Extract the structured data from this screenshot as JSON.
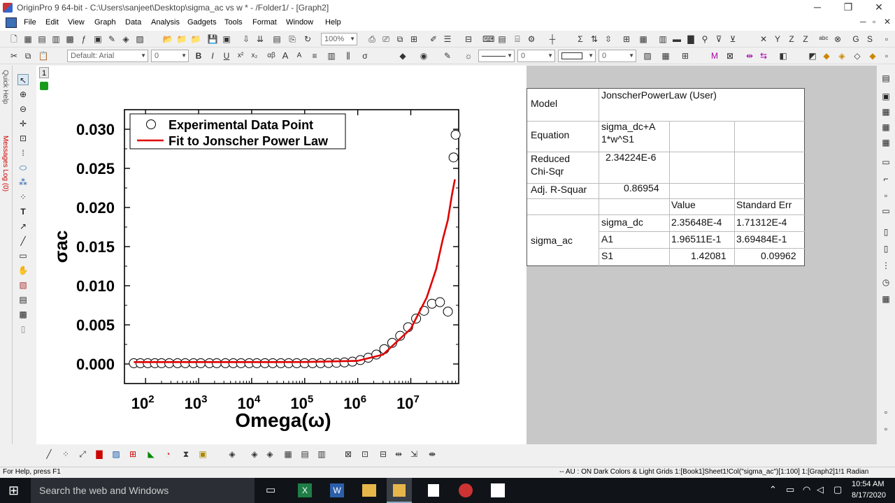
{
  "window": {
    "title": "OriginPro 9 64-bit - C:\\Users\\sanjeet\\Desktop\\sigma_ac vs w * - /Folder1/ - [Graph2]",
    "controls": [
      "─",
      "❐",
      "✕"
    ],
    "mdi_controls": [
      "─",
      "▫",
      "✕"
    ]
  },
  "menu": [
    "File",
    "Edit",
    "View",
    "Graph",
    "Data",
    "Analysis",
    "Gadgets",
    "Tools",
    "Format",
    "Window",
    "Help"
  ],
  "toolbar": {
    "zoom": "100%",
    "font_name": "Default: Arial",
    "font_size": "0",
    "bold": "B",
    "italic": "I",
    "underline": "U",
    "superscript": "x²",
    "subscript": "x₂",
    "greek": "αβ",
    "size_up": "A",
    "size_down": "A",
    "line_width": "0",
    "border_width": "0"
  },
  "sidebar": {
    "quick_help": "Quick Help",
    "messages_log": "Messages Log (0)"
  },
  "layer": {
    "number": "1"
  },
  "graph": {
    "y_title": "σac",
    "x_title": "Omega(ω)",
    "y_ticks": [
      "0.030",
      "0.025",
      "0.020",
      "0.015",
      "0.010",
      "0.005",
      "0.000"
    ],
    "x_ticks": [
      {
        "base": "10",
        "exp": "2"
      },
      {
        "base": "10",
        "exp": "3"
      },
      {
        "base": "10",
        "exp": "4"
      },
      {
        "base": "10",
        "exp": "5"
      },
      {
        "base": "10",
        "exp": "6"
      },
      {
        "base": "10",
        "exp": "7"
      }
    ],
    "legend": [
      "Experimental Data Point",
      "Fit to Jonscher Power Law"
    ],
    "colors": {
      "fit": "#e00000",
      "points": "#000000"
    }
  },
  "chart_data": {
    "type": "scatter",
    "title": "",
    "xlabel": "Omega(ω)",
    "ylabel": "σac",
    "x_scale": "log",
    "xlim": [
      40,
      80000000
    ],
    "ylim": [
      -0.0025,
      0.0325
    ],
    "grid": false,
    "legend_position": "top-left",
    "series": [
      {
        "name": "Experimental Data Point",
        "marker": "open-circle",
        "x": [
          60,
          80,
          110,
          150,
          200,
          280,
          400,
          560,
          800,
          1100,
          1600,
          2200,
          3200,
          4500,
          6300,
          9000,
          12500,
          17800,
          25000,
          35500,
          50000,
          70800,
          100000,
          141000,
          200000,
          282000,
          398000,
          562000,
          794000,
          1120000,
          1580000,
          2240000,
          3160000,
          4470000,
          6310000,
          8910000,
          12600000,
          17800000,
          25100000,
          35500000,
          50100000,
          64000000,
          70000000
        ],
        "y": [
          0.0001,
          0.0001,
          0.0001,
          0.0001,
          0.0001,
          0.0001,
          0.0001,
          0.0001,
          0.0001,
          0.0001,
          0.0001,
          0.0001,
          0.0001,
          0.0001,
          0.0001,
          0.0001,
          0.0001,
          0.0001,
          0.0001,
          0.0001,
          0.0001,
          0.0001,
          0.0001,
          0.0001,
          0.0001,
          0.00012,
          0.00015,
          0.0002,
          0.0003,
          0.0005,
          0.0008,
          0.0012,
          0.0019,
          0.0027,
          0.0036,
          0.0047,
          0.0058,
          0.0068,
          0.0077,
          0.0079,
          0.0067,
          0.0264,
          0.0293
        ]
      },
      {
        "name": "Fit to Jonscher Power Law",
        "style": "line",
        "x": [
          60,
          1000,
          10000,
          100000,
          1000000,
          3000000,
          10000000,
          20000000,
          30000000,
          40000000,
          50000000,
          60000000,
          68000000
        ],
        "y": [
          0.00024,
          0.00024,
          0.00024,
          0.00025,
          0.0004,
          0.0012,
          0.0045,
          0.0085,
          0.0121,
          0.0159,
          0.0184,
          0.0217,
          0.0236
        ]
      }
    ]
  },
  "results": {
    "model_label": "Model",
    "model_value": "JonscherPowerLaw (User)",
    "equation_label": "Equation",
    "equation_value_1": "sigma_dc+A",
    "equation_value_2": "1*w^S1",
    "chisq_label_1": "Reduced",
    "chisq_label_2": "Chi-Sqr",
    "chisq_value": "2.34224E-6",
    "r2_label": "Adj. R-Squar",
    "r2_value": "0.86954",
    "col_value": "Value",
    "col_error": "Standard Err",
    "group_label": "sigma_ac",
    "params": [
      {
        "name": "sigma_dc",
        "value": "2.35648E-4",
        "error": "1.71312E-4"
      },
      {
        "name": "A1",
        "value": "1.96511E-1",
        "error": "3.69484E-1"
      },
      {
        "name": "S1",
        "value": "1.42081",
        "error": "0.09962"
      }
    ]
  },
  "status": {
    "help": "For Help, press F1",
    "info": "-- AU : ON  Dark Colors & Light Grids  1:[Book1]Sheet1!Col(\"sigma_ac\")[1:100]  1:[Graph2]1!1  Radian"
  },
  "taskbar": {
    "search": "Search the web and Windows",
    "time": "10:54 AM",
    "date": "8/17/2020"
  }
}
